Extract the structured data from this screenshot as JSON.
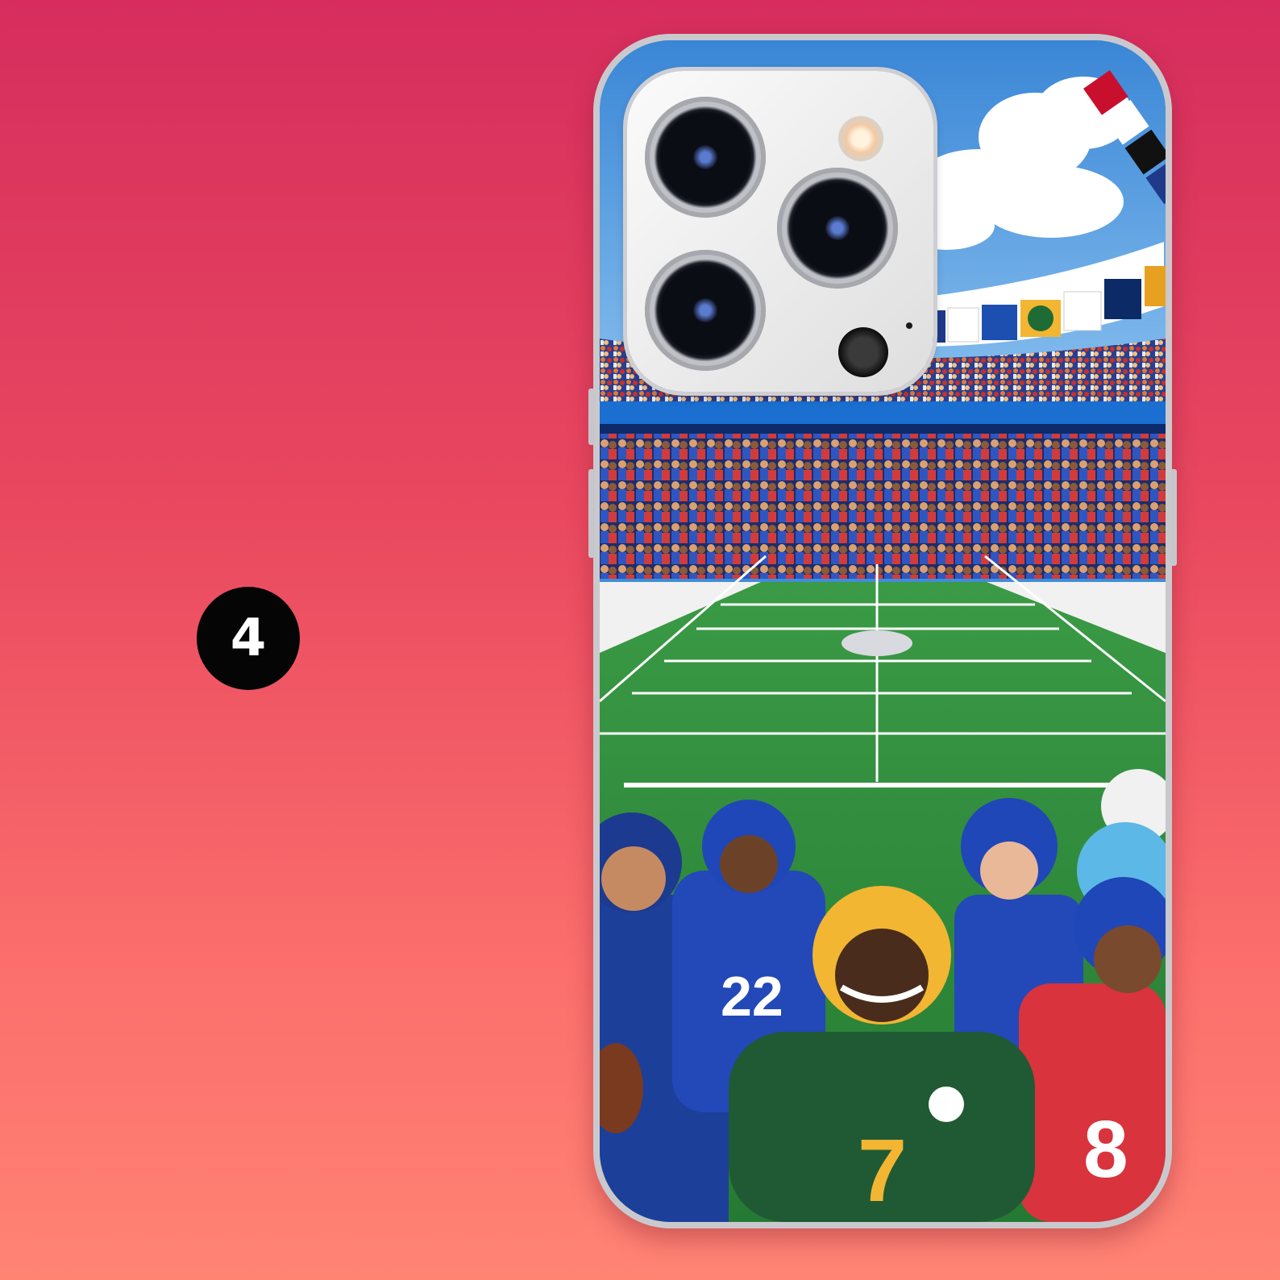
{
  "badge": {
    "label": "4"
  },
  "colors": {
    "background_top": "#d62d5e",
    "background_bottom": "#ff8474",
    "badge": "#050505",
    "field": "#2d8a3a",
    "sky": "#3f8ddb"
  },
  "icons": {
    "badge": "number-badge",
    "camera": "camera-icon"
  }
}
